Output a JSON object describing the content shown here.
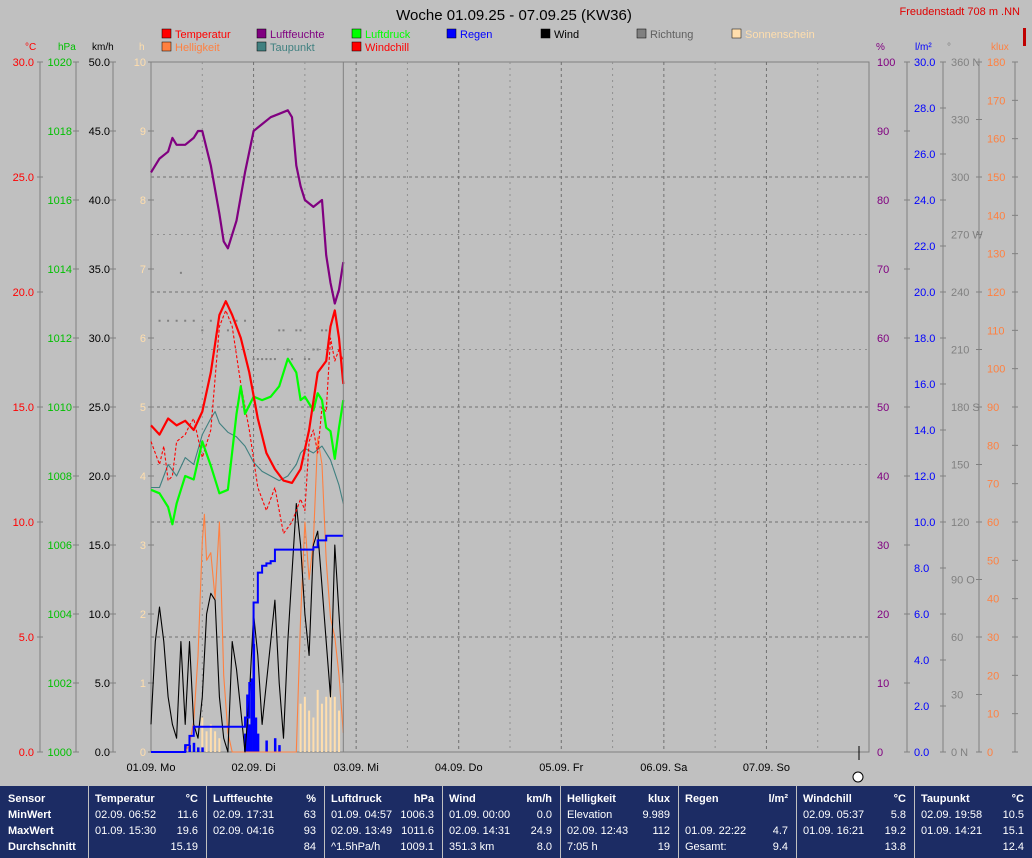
{
  "title": "Woche 01.09.25 - 07.09.25 (KW36)",
  "station": "Freudenstadt 708 m  .NN",
  "legend": [
    {
      "label": "Temperatur",
      "color": "#ff0000"
    },
    {
      "label": "Luftfeuchte",
      "color": "#800080"
    },
    {
      "label": "Luftdruck",
      "color": "#00ff00"
    },
    {
      "label": "Regen",
      "color": "#0000ff"
    },
    {
      "label": "Wind",
      "color": "#000000"
    },
    {
      "label": "Richtung",
      "color": "#808080"
    },
    {
      "label": "Sonnenschein",
      "color": "#ffdead"
    },
    {
      "label": "Helligkeit",
      "color": "#ff8040"
    },
    {
      "label": "Taupunkt",
      "color": "#408080"
    },
    {
      "label": "Windchill",
      "color": "#ff0000"
    }
  ],
  "chart_data": {
    "type": "line",
    "title": "Woche 01.09.25 - 07.09.25 (KW36)",
    "x_range_hours": [
      0,
      168
    ],
    "x_tick_labels": [
      "01.09.  Mo",
      "02.09.  Di",
      "03.09.  Mi",
      "04.09.  Do",
      "05.09.  Fr",
      "06.09.  Sa",
      "07.09.  So"
    ],
    "axes": {
      "temp": {
        "unit": "°C",
        "color": "#ff0000",
        "min": 0,
        "max": 30,
        "ticks": [
          "0.0",
          "5.0",
          "10.0",
          "15.0",
          "20.0",
          "25.0",
          "30.0"
        ]
      },
      "press": {
        "unit": "hPa",
        "color": "#00c000",
        "min": 1000,
        "max": 1020,
        "ticks": [
          "1000",
          "1002",
          "1004",
          "1006",
          "1008",
          "1010",
          "1012",
          "1014",
          "1016",
          "1018",
          "1020"
        ]
      },
      "wind": {
        "unit": "km/h",
        "color": "#000000",
        "min": 0,
        "max": 50,
        "ticks": [
          "0.0",
          "5.0",
          "10.0",
          "15.0",
          "20.0",
          "25.0",
          "30.0",
          "35.0",
          "40.0",
          "45.0",
          "50.0"
        ]
      },
      "sun": {
        "unit": "h",
        "color": "#ffdead",
        "min": 0,
        "max": 10,
        "ticks": [
          "0",
          "1",
          "2",
          "3",
          "4",
          "5",
          "6",
          "7",
          "8",
          "9",
          "10"
        ]
      },
      "hum": {
        "unit": "%",
        "color": "#800080",
        "min": 0,
        "max": 100,
        "ticks": [
          "0",
          "10",
          "20",
          "30",
          "40",
          "50",
          "60",
          "70",
          "80",
          "90",
          "100"
        ]
      },
      "rain": {
        "unit": "l/m²",
        "color": "#0000ff",
        "min": 0,
        "max": 30,
        "ticks": [
          "0.0",
          "2.0",
          "4.0",
          "6.0",
          "8.0",
          "10.0",
          "12.0",
          "14.0",
          "16.0",
          "18.0",
          "20.0",
          "22.0",
          "24.0",
          "26.0",
          "28.0",
          "30.0"
        ]
      },
      "dir": {
        "unit": "°",
        "color": "#808080",
        "min": 0,
        "max": 360,
        "ticks": [
          "0   N",
          "30",
          "60",
          "90  O",
          "120",
          "150",
          "180 S",
          "210",
          "240",
          "270 W",
          "300",
          "330",
          "360 N"
        ]
      },
      "lux": {
        "unit": "klux",
        "color": "#ff8040",
        "min": 0,
        "max": 180,
        "ticks": [
          "0",
          "10",
          "20",
          "30",
          "40",
          "50",
          "60",
          "70",
          "80",
          "90",
          "100",
          "110",
          "120",
          "130",
          "140",
          "150",
          "160",
          "170",
          "180"
        ]
      }
    },
    "series": [
      {
        "name": "Temperatur",
        "axis": "temp",
        "color": "#ff0000",
        "x": [
          0,
          2,
          4,
          6,
          8,
          10,
          12,
          14,
          16,
          17.5,
          19,
          21,
          23,
          25,
          27,
          29,
          31,
          33,
          35,
          37,
          39,
          41,
          42,
          43,
          44,
          45
        ],
        "y": [
          14.2,
          13.8,
          14.5,
          14.2,
          14.4,
          14.0,
          14.8,
          16.5,
          19.0,
          19.6,
          19.0,
          18.0,
          16.5,
          14.5,
          13.0,
          12.3,
          11.8,
          11.7,
          12.3,
          14.0,
          16.5,
          17.0,
          18.5,
          19.2,
          18.0,
          16.0
        ]
      },
      {
        "name": "Luftfeuchte",
        "axis": "hum",
        "color": "#800080",
        "x": [
          0,
          2,
          4,
          5,
          6,
          8,
          10,
          11,
          12,
          14,
          16,
          17,
          18,
          19,
          20,
          22,
          24,
          26,
          28,
          30,
          32,
          33,
          34,
          35,
          36,
          38,
          40,
          41,
          42,
          43,
          44,
          45
        ],
        "y": [
          84,
          86,
          87,
          89,
          88,
          88,
          89,
          90,
          90,
          85,
          78,
          74,
          73,
          75,
          77,
          84,
          90,
          91,
          92,
          92.5,
          93,
          92,
          85,
          82,
          80,
          79,
          80,
          72,
          68,
          65,
          67,
          71
        ]
      },
      {
        "name": "Luftdruck",
        "axis": "press",
        "color": "#00ff00",
        "x": [
          0,
          2,
          4,
          5,
          6,
          8,
          10,
          12,
          14,
          16,
          18,
          20,
          21,
          22,
          24,
          26,
          28,
          30,
          32,
          34,
          35,
          36,
          38,
          39,
          40,
          41,
          42,
          43,
          44,
          45
        ],
        "y": [
          1007.6,
          1007.5,
          1007.1,
          1006.6,
          1007.2,
          1008.0,
          1007.9,
          1009.0,
          1008.3,
          1007.5,
          1007.6,
          1009.8,
          1010.6,
          1009.8,
          1010.3,
          1010.2,
          1010.3,
          1010.6,
          1011.4,
          1011.0,
          1010.2,
          1010.3,
          1009.9,
          1010.4,
          1010.2,
          1009.4,
          1009.3,
          1008.5,
          1009.4,
          1010.2
        ]
      },
      {
        "name": "Taupunkt",
        "axis": "temp",
        "color": "#408080",
        "x": [
          0,
          2,
          4,
          6,
          8,
          10,
          12,
          14,
          15,
          16,
          18,
          20,
          22,
          24,
          26,
          28,
          30,
          32,
          34,
          35,
          36,
          38,
          40,
          42,
          44,
          45
        ],
        "y": [
          11.5,
          11.5,
          12.5,
          12.0,
          12.8,
          12.5,
          13.8,
          14.5,
          14.8,
          14.3,
          13.9,
          13.7,
          13.3,
          12.6,
          12.2,
          12.0,
          11.8,
          12.0,
          12.5,
          13.0,
          13.2,
          13.0,
          13.3,
          12.7,
          11.6,
          10.8
        ]
      },
      {
        "name": "Windchill",
        "axis": "temp",
        "color": "#ff0000",
        "dashed": true,
        "x": [
          0,
          2,
          3,
          4,
          5,
          6,
          8,
          9,
          10,
          12,
          14,
          16,
          17.5,
          19,
          21,
          23,
          25,
          27,
          29,
          31,
          33,
          35,
          36,
          37,
          38,
          39,
          40,
          41,
          42,
          43,
          44,
          45
        ],
        "y": [
          13.5,
          12.5,
          13.3,
          11.8,
          12.0,
          13.5,
          13.8,
          14.2,
          14.5,
          12.8,
          14.0,
          18.5,
          19.2,
          18.5,
          16.0,
          14.0,
          11.5,
          10.5,
          11.5,
          9.5,
          10.0,
          11.0,
          10.5,
          13.5,
          14.0,
          13.0,
          15.0,
          14.8,
          18.0,
          17.0,
          17.5,
          17.0
        ]
      },
      {
        "name": "Wind",
        "axis": "wind",
        "color": "#000000",
        "x": [
          0,
          1,
          2,
          3,
          4,
          5,
          6,
          7,
          8,
          9,
          10,
          11,
          12,
          13,
          14,
          15,
          16,
          17,
          18,
          19,
          20,
          21,
          22,
          23,
          24,
          25,
          26,
          27,
          28,
          29,
          30,
          31,
          32,
          33,
          34,
          35,
          36,
          37,
          38,
          39,
          40,
          41,
          42,
          43,
          44,
          45
        ],
        "y": [
          2,
          8,
          10.5,
          8,
          4,
          2,
          1,
          8,
          2,
          8,
          2,
          1,
          4,
          10,
          11.5,
          11,
          4,
          1,
          0,
          8,
          6,
          3,
          0,
          4,
          10,
          7,
          2,
          5,
          8,
          11,
          5,
          1,
          8,
          13,
          18,
          15,
          10,
          7,
          15,
          16,
          12,
          8,
          4,
          15,
          10,
          5
        ]
      },
      {
        "name": "Helligkeit",
        "axis": "lux",
        "color": "#ff8040",
        "x": [
          0,
          2,
          4,
          6,
          8,
          9,
          10,
          11,
          12,
          12.5,
          13,
          14,
          15,
          16,
          17,
          18,
          19,
          20,
          22,
          24,
          26,
          28,
          30,
          32,
          34,
          35,
          36,
          37,
          38,
          39,
          40,
          41,
          42,
          43,
          44,
          45
        ],
        "y": [
          0,
          0,
          0,
          0,
          0,
          2,
          8,
          25,
          55,
          62,
          50,
          52,
          40,
          60,
          20,
          5,
          0,
          0,
          0,
          0,
          0,
          0,
          0,
          0,
          0,
          35,
          60,
          45,
          55,
          82,
          75,
          50,
          35,
          30,
          20,
          5
        ]
      }
    ],
    "rain_sum": {
      "name": "Regen",
      "axis": "rain",
      "color": "#0000ff",
      "x": [
        0,
        7,
        8,
        9,
        10,
        14,
        20,
        22,
        23,
        24,
        25,
        26,
        27,
        28,
        29,
        30,
        31,
        32,
        33,
        35,
        36,
        37,
        38,
        39,
        40,
        41,
        42,
        43,
        44,
        45
      ],
      "y": [
        0,
        0,
        0.3,
        0.7,
        1.1,
        1.1,
        1.1,
        1.5,
        3.0,
        6.5,
        7.8,
        8.1,
        8.2,
        8.3,
        8.8,
        8.8,
        8.8,
        8.8,
        8.8,
        8.8,
        8.8,
        8.8,
        8.9,
        9.2,
        9.2,
        9.4,
        9.4,
        9.4,
        9.4,
        9.4
      ]
    },
    "rain_bars": {
      "axis": "rain",
      "color": "#0000ff",
      "x": [
        8,
        9,
        10,
        11,
        12,
        22,
        22.5,
        23,
        23.5,
        24,
        24.5,
        25,
        27,
        29,
        30
      ],
      "y": [
        0.3,
        0.3,
        0.4,
        0.2,
        0.2,
        0.8,
        2.5,
        1.2,
        3.2,
        4.7,
        1.5,
        0.8,
        0.5,
        0.6,
        0.3
      ]
    },
    "sun_bars": {
      "axis": "sun",
      "color": "#ffdead",
      "x": [
        12,
        13,
        14,
        15,
        16,
        35,
        36,
        37,
        38,
        39,
        40,
        41,
        42,
        43,
        44
      ],
      "y": [
        0.5,
        0.3,
        0.4,
        0.3,
        0.2,
        0.7,
        0.8,
        0.6,
        0.5,
        0.9,
        0.7,
        0.8,
        0.9,
        0.8,
        0.6
      ]
    },
    "direction_points": {
      "axis": "dir",
      "color": "#808080",
      "x": [
        2,
        4,
        6,
        7,
        8,
        10,
        12,
        14,
        16,
        18,
        20,
        22,
        24,
        25,
        26,
        27,
        28,
        29,
        30,
        31,
        32,
        33,
        34,
        35,
        36,
        37,
        38,
        39,
        40,
        41
      ],
      "y": [
        225,
        225,
        225,
        250,
        225,
        225,
        220,
        225,
        210,
        220,
        225,
        225,
        205,
        205,
        205,
        205,
        205,
        205,
        220,
        220,
        210,
        205,
        220,
        220,
        205,
        205,
        210,
        210,
        220,
        220
      ]
    }
  },
  "stats": {
    "headers": {
      "sensor": "Sensor",
      "rows": [
        "MinWert",
        "MaxWert",
        "Durchschnitt"
      ]
    },
    "columns": [
      {
        "name": "Temperatur",
        "unit": "°C",
        "rows": [
          [
            "02.09.  06:52",
            "11.6"
          ],
          [
            "01.09.  15:30",
            "19.6"
          ],
          [
            "",
            "15.19"
          ]
        ]
      },
      {
        "name": "Luftfeuchte",
        "unit": "%",
        "rows": [
          [
            "02.09.  17:31",
            "63"
          ],
          [
            "02.09.  04:16",
            "93"
          ],
          [
            "",
            "84"
          ]
        ]
      },
      {
        "name": "Luftdruck",
        "unit": "hPa",
        "rows": [
          [
            "01.09.  04:57",
            "1006.3"
          ],
          [
            "02.09.  13:49",
            "1011.6"
          ],
          [
            "^1.5hPa/h",
            "1009.1"
          ]
        ]
      },
      {
        "name": "Wind",
        "unit": "km/h",
        "rows": [
          [
            "01.09.  00:00",
            "0.0"
          ],
          [
            "02.09.  14:31",
            "24.9"
          ],
          [
            "351.3 km",
            "8.0"
          ]
        ]
      },
      {
        "name": "Helligkeit",
        "unit": "klux",
        "rows": [
          [
            "Elevation",
            "9.989"
          ],
          [
            "02.09.  12:43",
            "112"
          ],
          [
            "7:05 h",
            "19"
          ]
        ]
      },
      {
        "name": "Regen",
        "unit": "l/m²",
        "rows": [
          [
            "",
            ""
          ],
          [
            "01.09.  22:22",
            "4.7"
          ],
          [
            "Gesamt:",
            "9.4"
          ]
        ]
      },
      {
        "name": "Windchill",
        "unit": "°C",
        "rows": [
          [
            "02.09.  05:37",
            "5.8"
          ],
          [
            "01.09.  16:21",
            "19.2"
          ],
          [
            "",
            "13.8"
          ]
        ]
      },
      {
        "name": "Taupunkt",
        "unit": "°C",
        "rows": [
          [
            "02.09.  19:58",
            "10.5"
          ],
          [
            "01.09.  14:21",
            "15.1"
          ],
          [
            "",
            "12.4"
          ]
        ]
      }
    ]
  }
}
